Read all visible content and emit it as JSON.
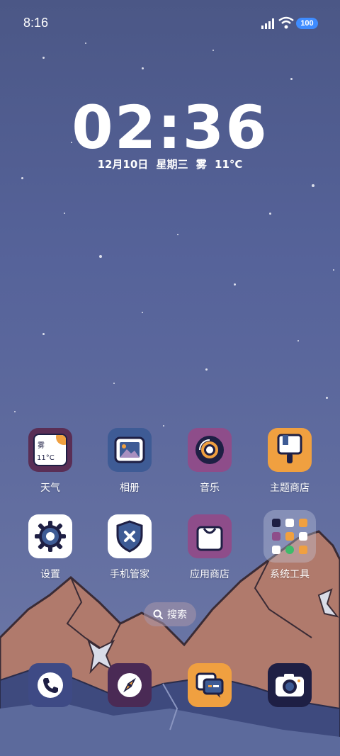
{
  "status_bar": {
    "time": "8:16",
    "battery": "100"
  },
  "lock_clock": {
    "time": "02:36",
    "date": "12月10日",
    "weekday": "星期三",
    "weather": "雾",
    "temperature": "11°C"
  },
  "apps": [
    {
      "label": "天气",
      "icon": "weather-icon",
      "widget_text": "雾",
      "widget_temp": "11°C"
    },
    {
      "label": "相册",
      "icon": "gallery-icon"
    },
    {
      "label": "音乐",
      "icon": "music-icon"
    },
    {
      "label": "主题商店",
      "icon": "theme-store-icon"
    },
    {
      "label": "设置",
      "icon": "gear-icon"
    },
    {
      "label": "手机管家",
      "icon": "security-shield-icon"
    },
    {
      "label": "应用商店",
      "icon": "app-store-icon"
    },
    {
      "label": "系统工具",
      "icon": "folder-icon"
    }
  ],
  "search": {
    "label": "搜索"
  },
  "dock": [
    {
      "icon": "phone-icon"
    },
    {
      "icon": "browser-compass-icon"
    },
    {
      "icon": "messages-icon"
    },
    {
      "icon": "camera-icon"
    }
  ],
  "colors": {
    "wallpaper": "#56639a",
    "accent_orange": "#f0a040",
    "accent_purple": "#8e4d8a",
    "dark_navy": "#1e1f44"
  }
}
